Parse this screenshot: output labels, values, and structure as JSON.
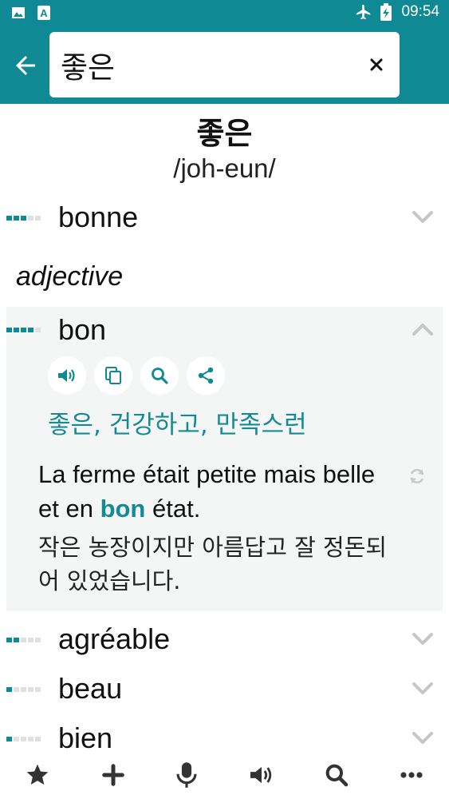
{
  "status_bar": {
    "time": "09:54",
    "icons": [
      "image-icon",
      "a-icon",
      "airplane-icon",
      "battery-charging-icon"
    ]
  },
  "search": {
    "value": "좋은",
    "placeholder": ""
  },
  "entry": {
    "headword": "좋은",
    "pronunciation": "/joh-eun/"
  },
  "translations_top": [
    {
      "word": "bonne",
      "frequency": 3
    }
  ],
  "part_of_speech": "adjective",
  "expanded": {
    "word": "bon",
    "frequency": 4,
    "actions": [
      "speaker-icon",
      "copy-icon",
      "search-icon",
      "share-icon"
    ],
    "synonyms": "좋은, 건강하고, 만족스런",
    "example_fr_before": "La ferme était petite mais belle et en ",
    "example_fr_highlight": "bon",
    "example_fr_after": " état.",
    "example_ko": "작은 농장이지만 아름답고 잘 정돈되어 있었습니다."
  },
  "translations_bottom": [
    {
      "word": "agréable",
      "frequency": 2
    },
    {
      "word": "beau",
      "frequency": 1
    },
    {
      "word": "bien",
      "frequency": 1
    }
  ],
  "toolbar": [
    "star-icon",
    "plus-icon",
    "microphone-icon",
    "speaker-icon",
    "search-icon",
    "more-icon"
  ],
  "colors": {
    "primary": "#0f8a94",
    "accent_text": "#168a93",
    "card_bg": "#f4f6f6",
    "freq_off": "#e0e0e0"
  }
}
